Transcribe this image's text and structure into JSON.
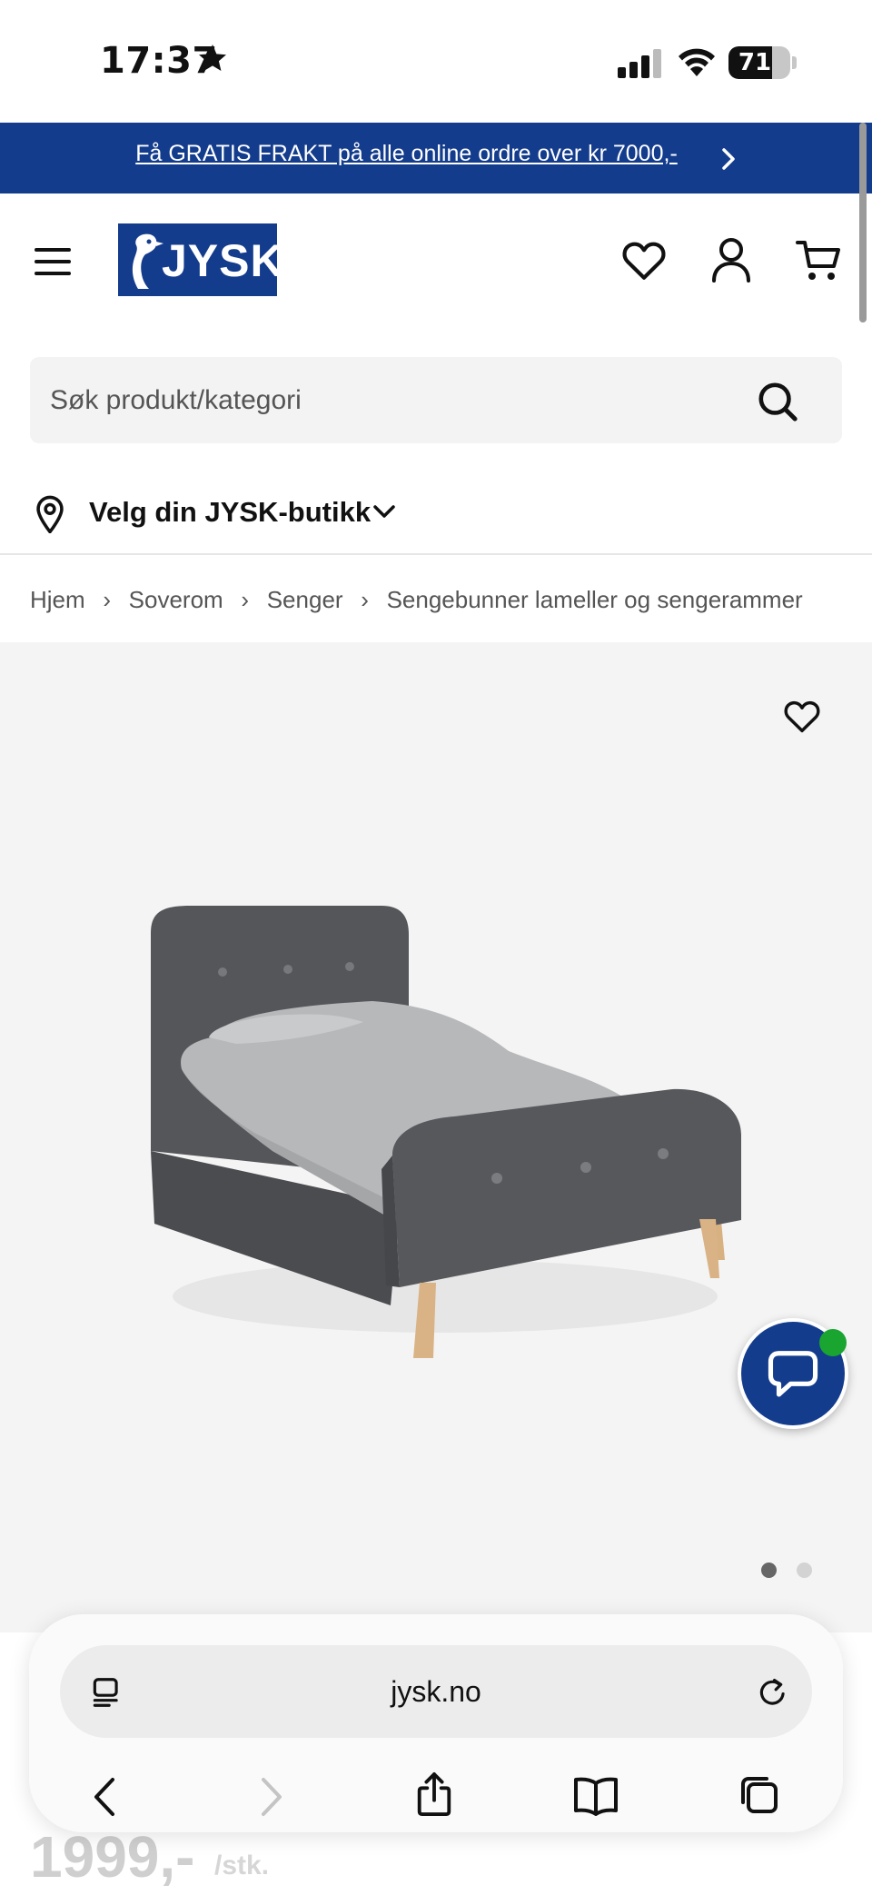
{
  "status_bar": {
    "time": "17:37",
    "battery": "71",
    "battery_level": 0.71
  },
  "promo": {
    "text": "Få GRATIS FRAKT på alle online ordre over kr 7000,-"
  },
  "header": {
    "logo_text": "JYSK"
  },
  "search": {
    "placeholder": "Søk produkt/kategori"
  },
  "store": {
    "label": "Velg din JYSK-butikk"
  },
  "breadcrumb": {
    "items": [
      "Hjem",
      "Soverom",
      "Senger",
      "Sengebunner lameller og sengerammer"
    ],
    "separator": "›"
  },
  "gallery": {
    "current_index": 1,
    "total": 2
  },
  "product": {
    "price": "1999,-",
    "unit": "/stk."
  },
  "browser": {
    "url": "jysk.no"
  },
  "colors": {
    "brand_blue": "#143c8c",
    "online_green": "#1aa531",
    "image_bg": "#f4f4f4"
  },
  "icons": [
    "star-icon",
    "signal-icon",
    "wifi-icon",
    "battery-icon",
    "chevron-right-icon",
    "menu-icon",
    "heart-icon",
    "user-icon",
    "cart-icon",
    "search-icon",
    "location-pin-icon",
    "chevron-down-icon",
    "chat-icon",
    "reader-icon",
    "reload-icon",
    "back-icon",
    "forward-icon",
    "share-icon",
    "bookmarks-icon",
    "tabs-icon"
  ]
}
